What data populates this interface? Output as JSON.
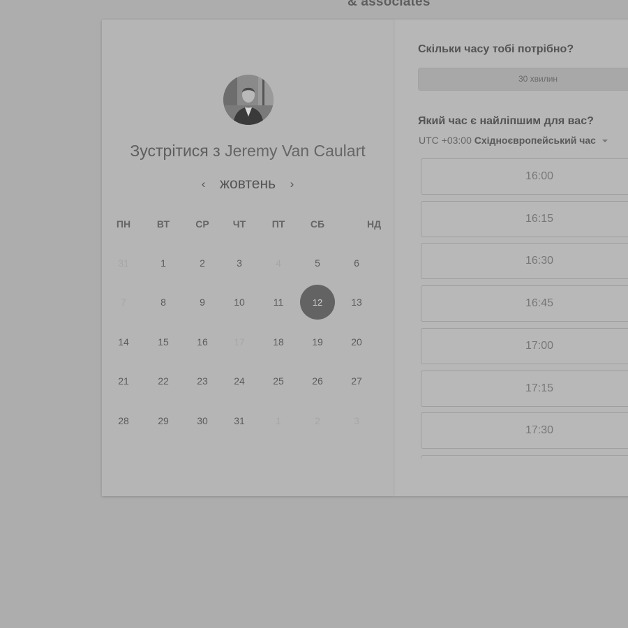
{
  "brand": {
    "text": "& associates"
  },
  "host": {
    "prefix": "Зустрітися з",
    "name": "Jeremy Van Caulart"
  },
  "calendar": {
    "month": "жовтень",
    "prev_icon": "chevron-left-icon",
    "next_icon": "chevron-right-icon",
    "weekdays": [
      "ПН",
      "ВТ",
      "СР",
      "ЧТ",
      "ПТ",
      "СБ",
      "НД"
    ],
    "weeks": [
      [
        {
          "d": "31",
          "muted": true
        },
        {
          "d": "1"
        },
        {
          "d": "2"
        },
        {
          "d": "3"
        },
        {
          "d": "4",
          "muted": true
        },
        {
          "d": "5"
        },
        {
          "d": "6"
        }
      ],
      [
        {
          "d": "7",
          "muted": true
        },
        {
          "d": "8"
        },
        {
          "d": "9"
        },
        {
          "d": "10"
        },
        {
          "d": "11"
        },
        {
          "d": "12",
          "selected": true
        },
        {
          "d": "13"
        }
      ],
      [
        {
          "d": "14"
        },
        {
          "d": "15"
        },
        {
          "d": "16"
        },
        {
          "d": "17",
          "muted": true
        },
        {
          "d": "18"
        },
        {
          "d": "19"
        },
        {
          "d": "20"
        }
      ],
      [
        {
          "d": "21"
        },
        {
          "d": "22"
        },
        {
          "d": "23"
        },
        {
          "d": "24"
        },
        {
          "d": "25"
        },
        {
          "d": "26"
        },
        {
          "d": "27"
        }
      ],
      [
        {
          "d": "28"
        },
        {
          "d": "29"
        },
        {
          "d": "30"
        },
        {
          "d": "31"
        },
        {
          "d": "1",
          "muted": true
        },
        {
          "d": "2",
          "muted": true
        },
        {
          "d": "3",
          "muted": true
        }
      ]
    ],
    "selected_day": "12"
  },
  "booking": {
    "duration_question": "Скільки часу тобі потрібно?",
    "duration_value": "30 хвилин",
    "time_question": "Який час є найліпшим для вас?",
    "timezone_offset": "UTC +03:00",
    "timezone_name": "Східноєвропейський час",
    "timezone_icon": "caret-down-icon",
    "slots": [
      "16:00",
      "16:15",
      "16:30",
      "16:45",
      "17:00",
      "17:15",
      "17:30",
      ""
    ]
  },
  "colors": {
    "background": "#adadad",
    "selected_day": "#636363",
    "slot_border": "#9e9e9e"
  }
}
